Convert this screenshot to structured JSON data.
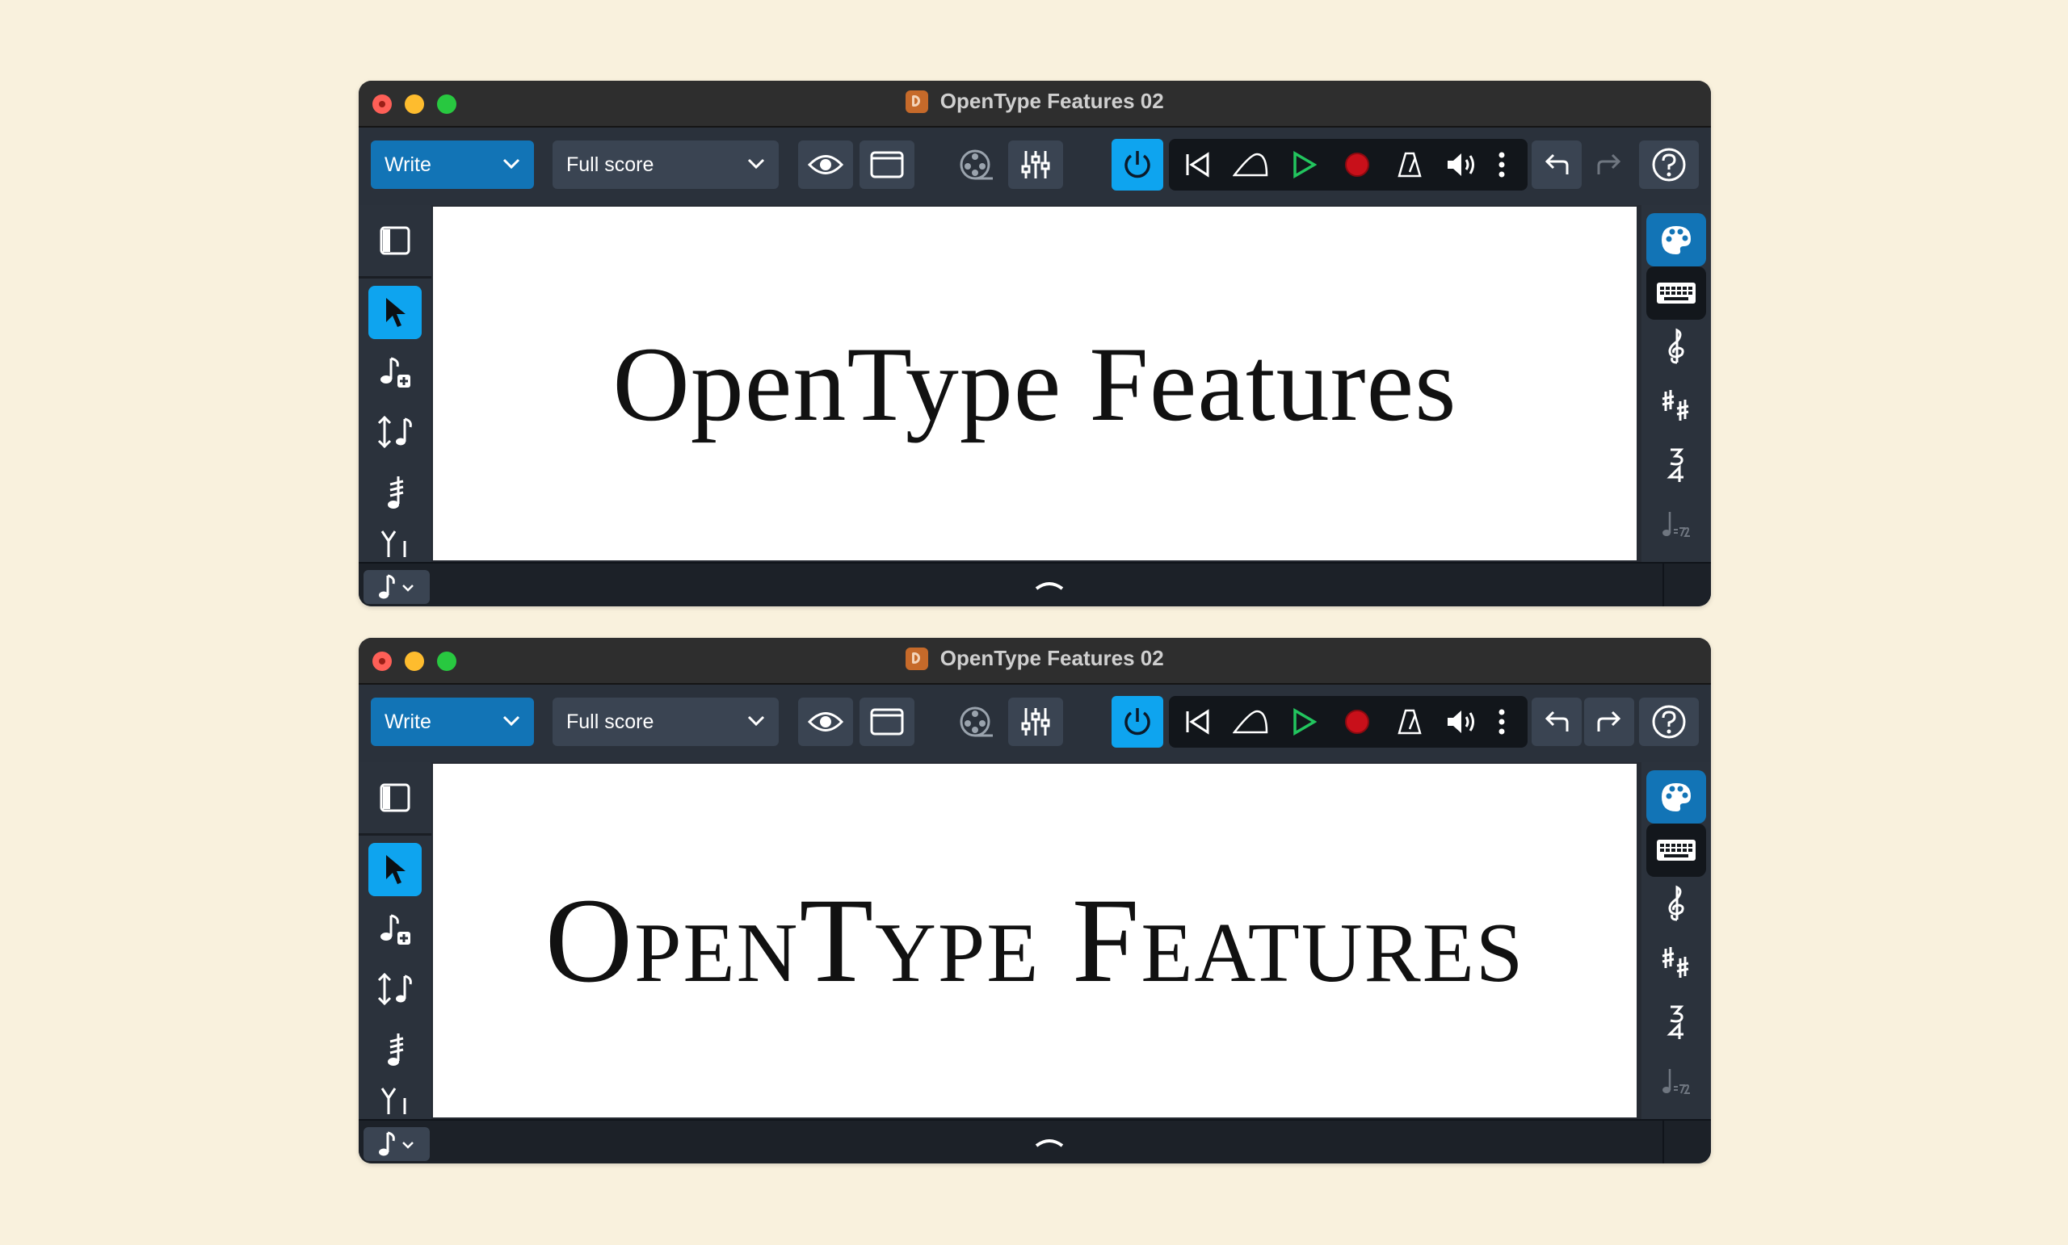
{
  "windows": [
    {
      "title": "OpenType Features 02",
      "mode": "Write",
      "layout": "Full score",
      "score_text": "OpenType Features",
      "redo_enabled": false
    },
    {
      "title": "OpenType Features 02",
      "mode": "Write",
      "layout": "Full score",
      "score_text": "OpenType Features",
      "redo_enabled": true
    }
  ],
  "colors": {
    "background": "#f9f1dd",
    "accent": "#1274b6",
    "power": "#0ea4ef",
    "play": "#22c55e",
    "record": "#c8101a"
  },
  "icons": [
    "traffic-lights",
    "dorico-app-icon",
    "chevron-down-icon",
    "eye-icon",
    "window-icon",
    "video-reel-icon",
    "mixer-icon",
    "power-icon",
    "rewind-icon",
    "metronome-shape-icon",
    "play-icon",
    "record-icon",
    "click-icon",
    "speaker-icon",
    "more-icon",
    "undo-icon",
    "redo-icon",
    "help-icon",
    "panel-toggle-icon",
    "select-arrow-icon",
    "note-input-icon",
    "insert-icon",
    "tremolo-icon",
    "tuplet-icon",
    "note-value-icon",
    "palette-icon",
    "keyboard-icon",
    "clef-icon",
    "key-signature-icon",
    "time-signature-icon",
    "tempo-icon",
    "collapse-up-icon"
  ]
}
